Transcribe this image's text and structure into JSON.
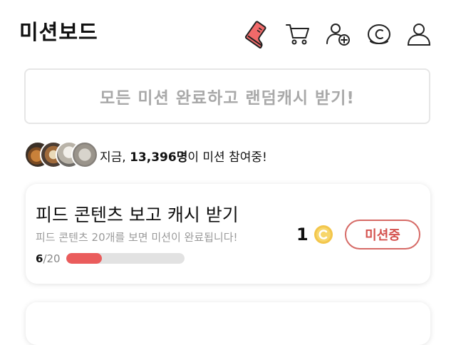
{
  "header": {
    "title": "미션보드",
    "icons": [
      "shoe-icon",
      "cart-icon",
      "add-user-icon",
      "cash-coin-icon",
      "profile-icon"
    ]
  },
  "banner": {
    "text": "모든 미션 완료하고 랜덤캐시 받기!"
  },
  "participants": {
    "prefix": "지금, ",
    "count": "13,396명",
    "suffix": "이 미션 참여중!"
  },
  "mission": {
    "title": "피드 콘텐츠 보고 캐시 받기",
    "description": "피드 콘텐츠 20개를 보면 미션이 완료됩니다!",
    "progress_current": "6",
    "progress_total": "/20",
    "progress_fraction": 0.3,
    "reward": "1",
    "reward_icon": "coin-icon",
    "button_label": "미션중",
    "accent_color": "#d4514d"
  }
}
